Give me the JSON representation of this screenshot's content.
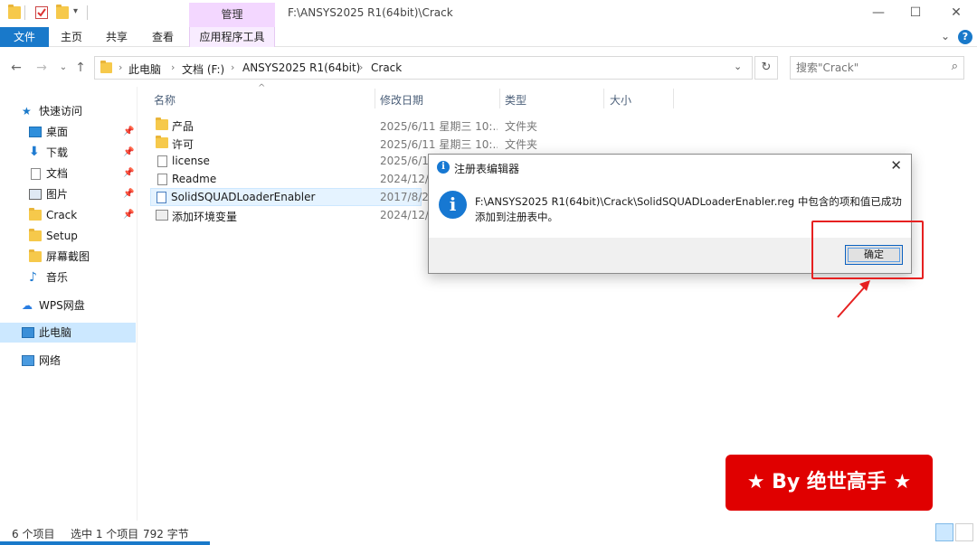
{
  "window": {
    "title": "F:\\ANSYS2025 R1(64bit)\\Crack",
    "context_tab_header": "管理",
    "minimize": "—",
    "maximize": "☐",
    "close": "✕"
  },
  "ribbon": {
    "tabs": [
      "文件",
      "主页",
      "共享",
      "查看",
      "应用程序工具"
    ],
    "collapse": "⌄",
    "help": "?"
  },
  "address": {
    "crumbs": [
      "此电脑",
      "文档 (F:)",
      "ANSYS2025 R1(64bit)",
      "Crack"
    ],
    "search_placeholder": "搜索\"Crack\""
  },
  "sidebar": {
    "quick_access": "快速访问",
    "items": [
      {
        "label": "桌面",
        "pinned": true
      },
      {
        "label": "下载",
        "pinned": true
      },
      {
        "label": "文档",
        "pinned": true
      },
      {
        "label": "图片",
        "pinned": true
      },
      {
        "label": "Crack",
        "pinned": true
      },
      {
        "label": "Setup",
        "pinned": false
      },
      {
        "label": "屏幕截图",
        "pinned": false
      },
      {
        "label": "音乐",
        "pinned": false
      }
    ],
    "wps": "WPS网盘",
    "this_pc": "此电脑",
    "network": "网络"
  },
  "filelist": {
    "columns": [
      "名称",
      "修改日期",
      "类型",
      "大小"
    ],
    "files": [
      {
        "name": "产品",
        "date": "2025/6/11 星期三 10:...",
        "type": "文件夹"
      },
      {
        "name": "许可",
        "date": "2025/6/11 星期三 10:...",
        "type": "文件夹"
      },
      {
        "name": "license",
        "date": "2025/6/11",
        "type": ""
      },
      {
        "name": "Readme",
        "date": "2024/12/2",
        "type": ""
      },
      {
        "name": "SolidSQUADLoaderEnabler",
        "date": "2017/8/26",
        "type": ""
      },
      {
        "name": "添加环境变量",
        "date": "2024/12/2",
        "type": ""
      }
    ]
  },
  "dialog": {
    "title": "注册表编辑器",
    "message_line1": "F:\\ANSYS2025 R1(64bit)\\Crack\\SolidSQUADLoaderEnabler.reg 中包含的项和值已成功",
    "message_line2": "添加到注册表中。",
    "ok": "确定"
  },
  "banner": {
    "text": "★ By 绝世高手 ★"
  },
  "status": {
    "count": "6 个项目",
    "selected": "选中 1 个项目",
    "size": "792 字节"
  },
  "colors": {
    "accent": "#1979ca",
    "highlight": "#e62020",
    "banner": "#e00000",
    "manage_tab": "#f3d7ff"
  }
}
